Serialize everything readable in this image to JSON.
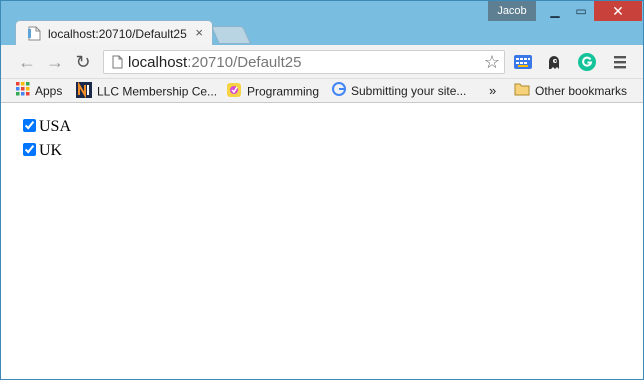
{
  "window": {
    "user": "Jacob",
    "minimize_glyph": "▁",
    "maximize_glyph": "▭",
    "close_glyph": "✕"
  },
  "tab": {
    "title": "localhost:20710/Default25",
    "close_glyph": "×"
  },
  "toolbar": {
    "back_glyph": "←",
    "forward_glyph": "→",
    "reload_glyph": "↻",
    "url_host": "localhost",
    "url_rest": ":20710/Default25",
    "star_glyph": "☆"
  },
  "bookmarks": {
    "apps": "Apps",
    "llc": "LLC Membership Ce...",
    "programming": "Programming",
    "submitting": "Submitting your site...",
    "more": "»",
    "other": "Other bookmarks"
  },
  "page": {
    "checkboxes": [
      {
        "label": "USA",
        "checked": true
      },
      {
        "label": "UK",
        "checked": true
      }
    ]
  },
  "colors": {
    "frame": "#79bde0",
    "close_button": "#c8413a",
    "grammarly": "#15c39a"
  },
  "icons": [
    "page-icon",
    "star-icon",
    "keyboard-icon",
    "ghost-icon",
    "grammarly-icon",
    "menu-icon",
    "apps-grid-icon",
    "folder-icon"
  ]
}
